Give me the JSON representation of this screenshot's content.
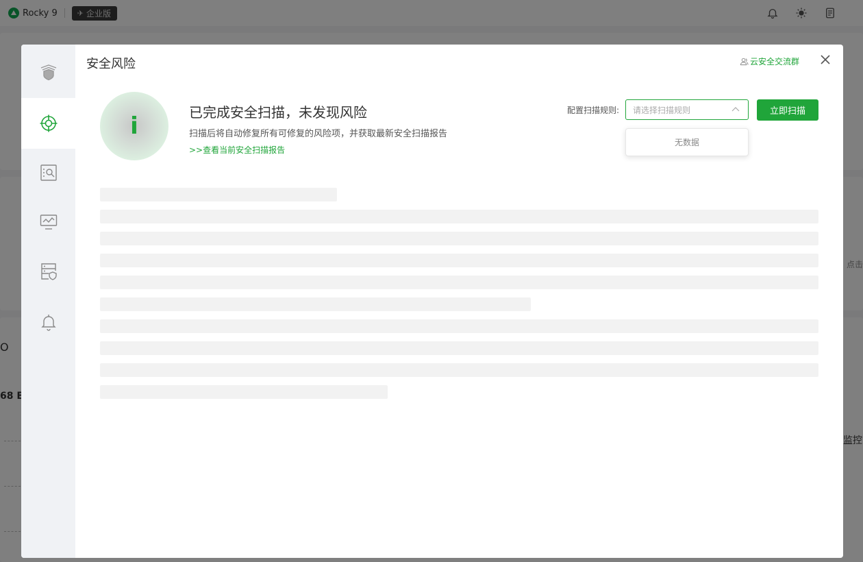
{
  "topbar": {
    "brand": "Rocky 9",
    "edition": "企业版",
    "icons": [
      "bell-icon",
      "theme-sun-icon",
      "notes-icon"
    ]
  },
  "background": {
    "left_text_1": "O",
    "left_text_2": "68 B",
    "right_text_1": "点击",
    "right_text_2": "监控"
  },
  "sidebar": {
    "items": [
      {
        "name": "shield-home",
        "icon": "shield-layers-icon",
        "active": false
      },
      {
        "name": "security-risk",
        "icon": "crosshair-target-icon",
        "active": true
      },
      {
        "name": "scan-search",
        "icon": "file-search-icon",
        "active": false
      },
      {
        "name": "monitor",
        "icon": "monitor-chart-icon",
        "active": false
      },
      {
        "name": "server-protect",
        "icon": "server-shield-icon",
        "active": false
      },
      {
        "name": "alerts",
        "icon": "bell-icon",
        "active": false
      }
    ]
  },
  "modal": {
    "title": "安全风险",
    "community_link": "云安全交流群",
    "status": {
      "glyph": "i",
      "title": "已完成安全扫描，未发现风险",
      "description": "扫描后将自动修复所有可修复的风险项，并获取最新安全扫描报告",
      "report_link": ">>查看当前安全扫描报告"
    },
    "scan_rule": {
      "label": "配置扫描规则:",
      "placeholder": "请选择扫描规则",
      "dropdown_empty": "无数据"
    },
    "scan_button": "立即扫描"
  },
  "colors": {
    "accent": "#20a53a",
    "overlay": "rgba(0,0,0,0.5)",
    "skeleton": "#f2f2f2"
  }
}
